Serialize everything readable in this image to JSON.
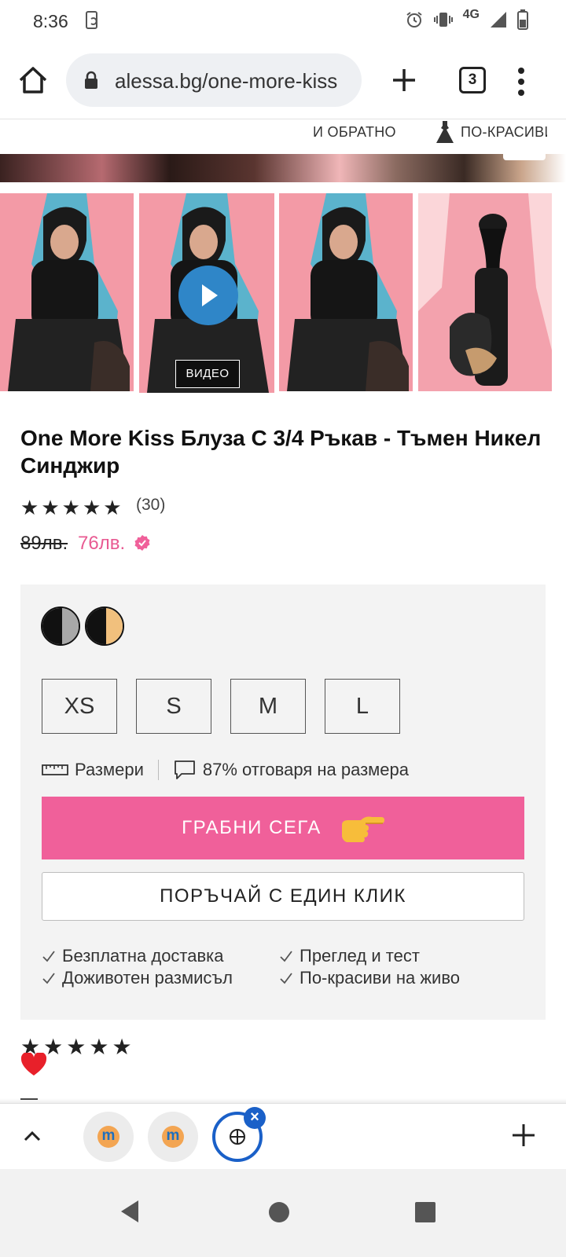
{
  "status": {
    "time": "8:36",
    "network": "4G"
  },
  "browser": {
    "url": "alessa.bg/one-more-kiss",
    "tab_count": "3"
  },
  "header_strip": {
    "text_left": "И ОБРАТНО",
    "text_right": "ПО-КРАСИВИ"
  },
  "gallery": {
    "video_label": "ВИДЕО",
    "thumbnail_count": 4
  },
  "product": {
    "title": "One More Kiss Блуза С 3/4 Ръкав - Тъмен Никел Синджир",
    "rating": 5,
    "reviews": "(30)",
    "price_old": "89лв.",
    "price_new": "76лв."
  },
  "options": {
    "swatches": [
      {
        "name": "black-grey",
        "colors": [
          "#111111",
          "#a8a8a8"
        ]
      },
      {
        "name": "black-beige",
        "colors": [
          "#111111",
          "#f1c07d"
        ]
      }
    ],
    "sizes": [
      "XS",
      "S",
      "M",
      "L"
    ],
    "size_guide_label": "Размери",
    "fit_label": "87% отговаря на размера",
    "cta_label": "ГРАБНИ СЕГА",
    "one_click_label": "ПОРЪЧАЙ С ЕДИН КЛИК",
    "benefits": [
      "Безплатна доставка",
      "Преглед и тест",
      "Доживотен размисъл",
      "По-красиви на живо"
    ]
  },
  "colors": {
    "accent_pink": "#f0609a",
    "price_pink": "#e85a92",
    "panel_bg": "#f3f3f3",
    "tab_blue": "#1a60c8"
  }
}
